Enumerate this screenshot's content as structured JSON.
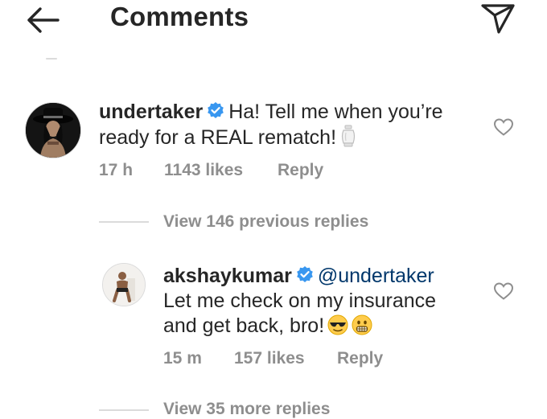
{
  "header": {
    "title": "Comments",
    "back_icon": "arrow-left-icon",
    "send_icon": "paper-plane-icon"
  },
  "comments": [
    {
      "username": "undertaker",
      "verified": true,
      "text_line1": "Ha! Tell me when you’re",
      "text_line2": "ready for a REAL rematch!",
      "emoji": "urn-icon",
      "time": "17 h",
      "likes": "1143 likes",
      "reply": "Reply"
    },
    {
      "username": "akshaykumar",
      "verified": true,
      "mention": "@undertaker",
      "text_line1": "Let me check on my insurance",
      "text_line2": "and get back, bro!",
      "emojis": [
        "smiling-face-with-sunglasses",
        "grimacing-face"
      ],
      "time": "15 m",
      "likes": "157 likes",
      "reply": "Reply"
    }
  ],
  "view_previous_replies": "View 146 previous replies",
  "view_more_replies": "View 35 more replies",
  "colors": {
    "text": "#262626",
    "secondary": "#8e8e8e",
    "verified_blue": "#3897f0",
    "mention": "#00376b",
    "divider": "#dbdbdb"
  }
}
